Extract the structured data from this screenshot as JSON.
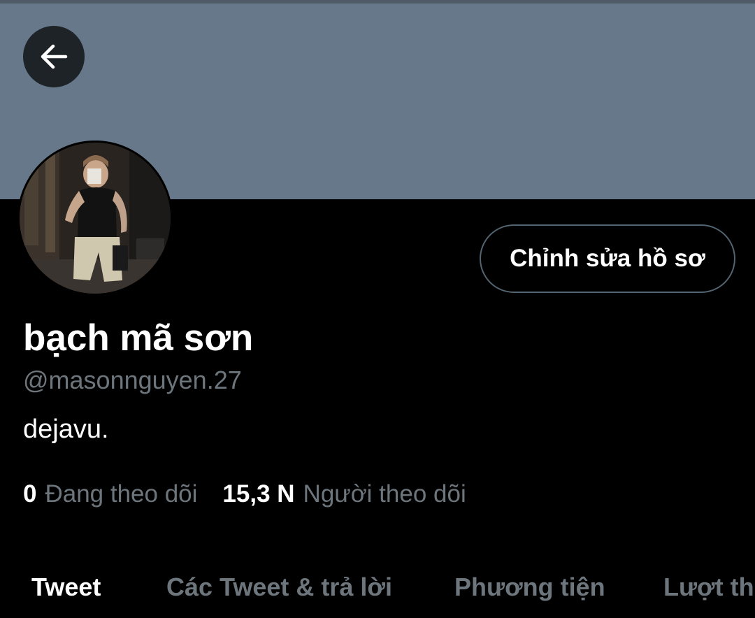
{
  "colors": {
    "background": "#000000",
    "banner": "#66788a",
    "secondary_text": "#6e767d",
    "primary_text": "#ffffff",
    "button_border": "#536471"
  },
  "header": {
    "back_icon": "arrow-left-icon"
  },
  "profile": {
    "avatar": "profile-photo",
    "edit_button_label": "Chỉnh sửa hồ sơ",
    "display_name": "bạch mã sơn",
    "handle": "@masonnguyen.27",
    "bio": "dejavu."
  },
  "stats": {
    "following_count": "0",
    "following_label": "Đang theo dõi",
    "followers_count": "15,3 N",
    "followers_label": "Người theo dõi"
  },
  "tabs": [
    {
      "label": "Tweet",
      "active": true
    },
    {
      "label": "Các Tweet & trả lời",
      "active": false
    },
    {
      "label": "Phương tiện",
      "active": false
    },
    {
      "label": "Lượt thí",
      "active": false
    }
  ]
}
